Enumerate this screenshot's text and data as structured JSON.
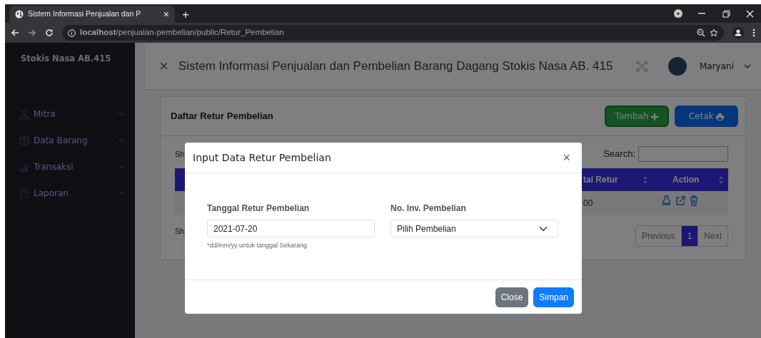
{
  "browser": {
    "tab_title": "Sistem Informasi Penjualan dan P",
    "tab_close": "×",
    "new_tab": "+",
    "url": "**localhost**/penjualan-pembelian/public/Retur_Pembelian"
  },
  "sidebar": {
    "brand": "Stokis Nasa AB.415",
    "items": [
      {
        "label": "Mitra"
      },
      {
        "label": "Data Barang"
      },
      {
        "label": "Transaksi"
      },
      {
        "label": "Laporan"
      }
    ]
  },
  "header": {
    "close": "×",
    "title": "Sistem Informasi Penjualan dan Pembelian Barang Dagang Stokis Nasa AB. 415",
    "user_name": "Maryani"
  },
  "card": {
    "title": "Daftar Retur Pembelian",
    "buttons": [
      {
        "label": "Tambah",
        "kind": "add"
      },
      {
        "label": "Cetak",
        "kind": "print"
      }
    ],
    "show_entries": "Sh",
    "search_label": "Search:",
    "columns": [
      "tal Retur",
      "Action"
    ],
    "row": {
      "cell": "00"
    },
    "info": "Sh",
    "pagination": [
      {
        "label": "Previous",
        "selected": false
      },
      {
        "label": "1",
        "selected": true
      },
      {
        "label": "Next",
        "selected": false
      }
    ]
  },
  "modal": {
    "title": "Input Data Retur Pembelian",
    "close": "×",
    "fields": [
      {
        "kind": "date",
        "label": "Tanggal Retur Pembelian",
        "value": "2021-07-20",
        "hint": "*dd/mm/yy untuk tanggal Sekarang"
      },
      {
        "kind": "select",
        "label": "No. Inv. Pembelian",
        "value": "Pilih Pembelian"
      }
    ],
    "buttons": [
      {
        "label": "Close",
        "kind": "secondary"
      },
      {
        "label": "Simpan",
        "kind": "primary"
      }
    ]
  }
}
